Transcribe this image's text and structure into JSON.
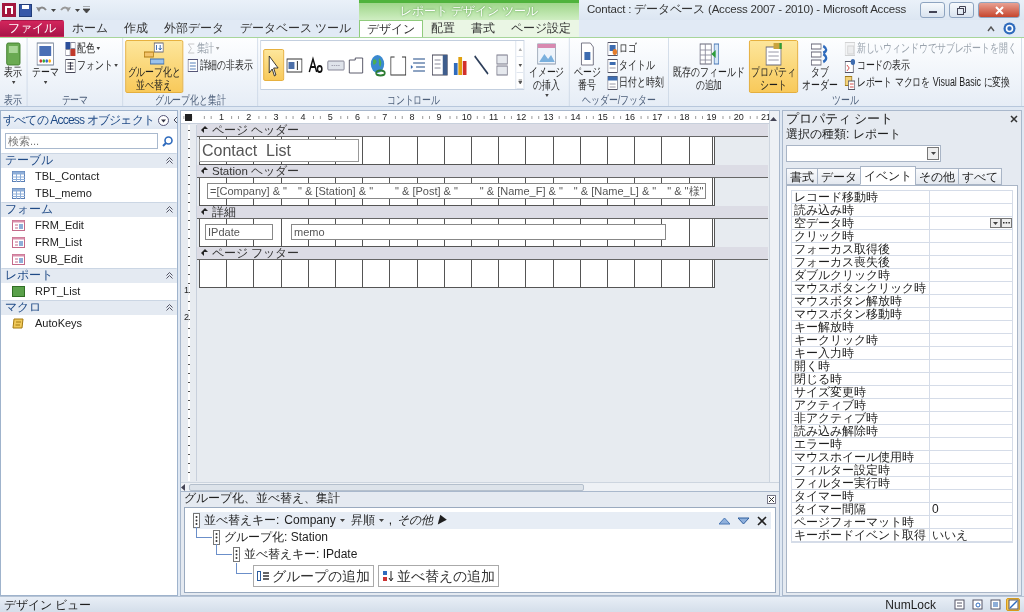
{
  "window": {
    "title": "Contact : データベース (Access 2007 - 2010) - Microsoft Access",
    "context_group": "レポート デザイン ツール"
  },
  "ribbon_tabs": [
    {
      "label": "ファイル",
      "kind": "file",
      "selected": false
    },
    {
      "label": "ホーム",
      "kind": "normal",
      "selected": false
    },
    {
      "label": "作成",
      "kind": "normal",
      "selected": false
    },
    {
      "label": "外部データ",
      "kind": "normal",
      "selected": false
    },
    {
      "label": "データベース ツール",
      "kind": "normal",
      "selected": false
    },
    {
      "label": "デザイン",
      "kind": "context",
      "selected": true
    },
    {
      "label": "配置",
      "kind": "context",
      "selected": false
    },
    {
      "label": "書式",
      "kind": "context",
      "selected": false
    },
    {
      "label": "ページ設定",
      "kind": "context",
      "selected": false
    }
  ],
  "ribbon_groups": [
    {
      "label": "表示",
      "items": [
        {
          "kind": "large",
          "lines": [
            "表示"
          ],
          "dropdown": true,
          "active": false,
          "disabled": false
        }
      ]
    },
    {
      "label": "テーマ",
      "items": [
        {
          "kind": "large",
          "lines": [
            "テーマ"
          ],
          "dropdown": true,
          "active": false,
          "disabled": false
        },
        {
          "kind": "small",
          "label": "配色",
          "dropdown": true,
          "active": false,
          "disabled": false
        },
        {
          "kind": "small",
          "label": "フォント",
          "dropdown": true,
          "active": false,
          "disabled": false
        }
      ]
    },
    {
      "label": "グループ化と集計",
      "items": [
        {
          "kind": "large",
          "lines": [
            "グループ化と",
            "並べ替え"
          ],
          "dropdown": false,
          "active": true,
          "disabled": false
        },
        {
          "kind": "small",
          "label": "集計",
          "dropdown": true,
          "active": false,
          "disabled": true
        },
        {
          "kind": "small",
          "label": "詳細の非表示",
          "dropdown": false,
          "active": false,
          "disabled": false
        }
      ]
    },
    {
      "label": "コントロール",
      "items": [
        {
          "kind": "gallery",
          "tools": [
            {
              "selected": true
            },
            {
              "selected": false
            },
            {
              "selected": false
            },
            {
              "selected": false
            },
            {
              "selected": false
            },
            {
              "selected": false
            },
            {
              "selected": false
            },
            {
              "selected": false
            },
            {
              "selected": false
            },
            {
              "selected": false
            },
            {
              "selected": false
            },
            {
              "selected": false
            }
          ]
        },
        {
          "kind": "large",
          "lines": [
            "イメージ",
            "の挿入"
          ],
          "dropdown": true,
          "active": false,
          "disabled": false
        }
      ]
    },
    {
      "label": "ヘッダー/フッター",
      "items": [
        {
          "kind": "large",
          "lines": [
            "ページ",
            "番号"
          ],
          "dropdown": false,
          "active": false,
          "disabled": false
        },
        {
          "kind": "small",
          "label": "ロゴ",
          "dropdown": false,
          "active": false,
          "disabled": false
        },
        {
          "kind": "small",
          "label": "タイトル",
          "dropdown": false,
          "active": false,
          "disabled": false
        },
        {
          "kind": "small",
          "label": "日付と時刻",
          "dropdown": false,
          "active": false,
          "disabled": false
        }
      ]
    },
    {
      "label": "ツール",
      "items": [
        {
          "kind": "large",
          "lines": [
            "既存のフィールド",
            "の追加"
          ],
          "dropdown": false,
          "active": false,
          "disabled": false
        },
        {
          "kind": "large",
          "lines": [
            "プロパティ",
            "シート"
          ],
          "dropdown": false,
          "active": true,
          "disabled": false
        },
        {
          "kind": "large",
          "lines": [
            "タブ",
            "オーダー"
          ],
          "dropdown": false,
          "active": false,
          "disabled": false
        },
        {
          "kind": "small",
          "label": "新しいウィンドウでサブレポートを開く",
          "dropdown": false,
          "active": false,
          "disabled": true
        },
        {
          "kind": "small",
          "label": "コードの表示",
          "dropdown": false,
          "active": false,
          "disabled": false
        },
        {
          "kind": "small",
          "label": "レポート マクロを Visual Basic に変換",
          "dropdown": false,
          "active": false,
          "disabled": false
        }
      ]
    }
  ],
  "navigation_pane": {
    "title": "すべての Access オブジェクト",
    "search": {
      "placeholder": "検索..."
    },
    "groups": [
      {
        "label": "テーブル",
        "kind": "table",
        "items": [
          "TBL_Contact",
          "TBL_memo"
        ]
      },
      {
        "label": "フォーム",
        "kind": "form",
        "items": [
          "FRM_Edit",
          "FRM_List",
          "SUB_Edit"
        ]
      },
      {
        "label": "レポート",
        "kind": "report",
        "items": [
          "RPT_List"
        ]
      },
      {
        "label": "マクロ",
        "kind": "macro",
        "items": [
          "AutoKeys"
        ]
      }
    ]
  },
  "design_view": {
    "ruler": [
      "1",
      "2",
      "3",
      "4",
      "5",
      "6",
      "7",
      "8",
      "9",
      "10",
      "11",
      "12",
      "13",
      "14",
      "15",
      "16",
      "17",
      "18",
      "19",
      "20",
      "21"
    ],
    "vertical_ruler": [
      "1",
      "2"
    ],
    "sections": [
      {
        "label": "ページ ヘッダー",
        "controls": [
          {
            "kind": "label",
            "text": "Contact  List"
          }
        ]
      },
      {
        "label": "Station ヘッダー",
        "controls": [
          {
            "kind": "textbox",
            "text": "=[Company] & \"　\" & [Station] & \"　　\" & [Post] & \"　　\" & [Name_F] & \"　\" & [Name_L] & \"　\" & \"様\""
          }
        ]
      },
      {
        "label": "詳細",
        "controls": [
          {
            "kind": "textbox",
            "text": "IPdate"
          },
          {
            "kind": "textbox",
            "text": "memo"
          }
        ]
      },
      {
        "label": "ページ フッター"
      }
    ]
  },
  "group_pane": {
    "title": "グループ化、並べ替え、集計",
    "rows": [
      {
        "label": "並べ替えキー:",
        "field": "Company",
        "selected": true,
        "order": "昇順",
        "separator": ",",
        "more": "その他 ▶",
        "children": [
          {
            "label": "グループ化:",
            "field": "Station",
            "selected": false,
            "children": [
              {
                "label": "並べ替えキー:",
                "field": "IPdate",
                "selected": false
              }
            ]
          }
        ]
      }
    ],
    "buttons": [
      "グループの追加",
      "並べ替えの追加"
    ]
  },
  "property_sheet": {
    "title": "プロパティ シート",
    "selection_type": "選択の種類: レポート",
    "tabs": [
      {
        "label": "書式",
        "selected": false
      },
      {
        "label": "データ",
        "selected": false
      },
      {
        "label": "イベント",
        "selected": true
      },
      {
        "label": "その他",
        "selected": false
      },
      {
        "label": "すべて",
        "selected": false
      }
    ],
    "rows": [
      {
        "name": "レコード移動時",
        "selected": false
      },
      {
        "name": "読み込み時",
        "selected": false
      },
      {
        "name": "空データ時",
        "selected": true
      },
      {
        "name": "クリック時",
        "selected": false
      },
      {
        "name": "フォーカス取得後",
        "selected": false
      },
      {
        "name": "フォーカス喪失後",
        "selected": false
      },
      {
        "name": "ダブルクリック時",
        "selected": false
      },
      {
        "name": "マウスボタンクリック時",
        "selected": false
      },
      {
        "name": "マウスボタン解放時",
        "selected": false
      },
      {
        "name": "マウスボタン移動時",
        "selected": false
      },
      {
        "name": "キー解放時",
        "selected": false
      },
      {
        "name": "キークリック時",
        "selected": false
      },
      {
        "name": "キー入力時",
        "selected": false
      },
      {
        "name": "開く時",
        "selected": false
      },
      {
        "name": "閉じる時",
        "selected": false
      },
      {
        "name": "サイズ変更時",
        "selected": false
      },
      {
        "name": "アクティブ時",
        "selected": false
      },
      {
        "name": "非アクティブ時",
        "selected": false
      },
      {
        "name": "読み込み解除時",
        "selected": false
      },
      {
        "name": "エラー時",
        "selected": false
      },
      {
        "name": "マウスホイール使用時",
        "selected": false
      },
      {
        "name": "フィルター設定時",
        "selected": false
      },
      {
        "name": "フィルター実行時",
        "selected": false
      },
      {
        "name": "タイマー時",
        "selected": false
      },
      {
        "name": "タイマー間隔",
        "value": "0",
        "selected": false
      },
      {
        "name": "ページフォーマット時",
        "selected": false
      },
      {
        "name": "キーボードイベント取得",
        "value": "いいえ",
        "selected": false
      }
    ]
  },
  "status_bar": {
    "mode": "デザイン ビュー",
    "indicator": "NumLock",
    "views": [
      {
        "selected": false
      },
      {
        "selected": false
      },
      {
        "selected": false
      },
      {
        "selected": true
      }
    ]
  }
}
